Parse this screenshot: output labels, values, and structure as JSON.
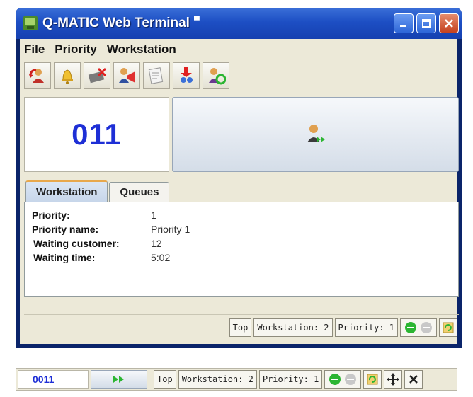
{
  "window": {
    "title": "Q-MATIC Web Terminal",
    "title_pin": "▀"
  },
  "menu": [
    {
      "label": "File"
    },
    {
      "label": "Priority"
    },
    {
      "label": "Workstation"
    }
  ],
  "toolbar": {
    "buttons": [
      {
        "icon": "recall-customer-icon"
      },
      {
        "icon": "bell-icon"
      },
      {
        "icon": "delete-ticket-icon"
      },
      {
        "icon": "announce-icon"
      },
      {
        "icon": "print-document-icon"
      },
      {
        "icon": "transfer-customer-icon"
      },
      {
        "icon": "redirect-customer-icon"
      }
    ]
  },
  "current_number": "011",
  "call_next": {
    "icon": "call-next-customer-icon"
  },
  "tabs": [
    {
      "label": "Workstation",
      "active": true
    },
    {
      "label": "Queues",
      "active": false
    }
  ],
  "workstation_info": [
    {
      "label": "Priority:",
      "value": "1"
    },
    {
      "label": "Priority name:",
      "value": "Priority 1"
    },
    {
      "label": "Waiting customer:",
      "value": "12"
    },
    {
      "label": "Waiting time:",
      "value": "5:02"
    }
  ],
  "status": {
    "top_label": "Top",
    "workstation": "Workstation: 2",
    "priority": "Priority: 1"
  },
  "compact": {
    "number": "0011",
    "top_label": "Top",
    "workstation": "Workstation: 2",
    "priority": "Priority: 1"
  },
  "colors": {
    "number": "#1e2fd6",
    "title_bar": "#1d4fc4",
    "status_green": "#2bb532"
  }
}
